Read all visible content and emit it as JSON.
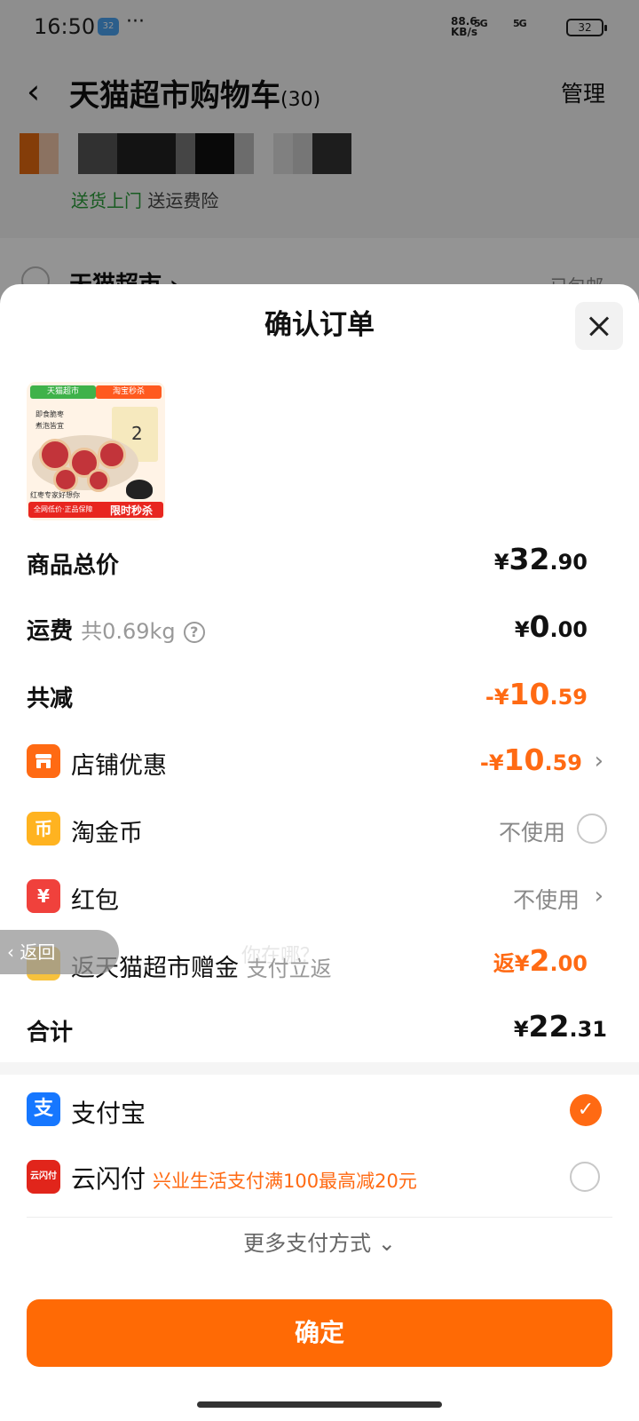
{
  "status_bar": {
    "time": "16:50",
    "weather_badge": "32",
    "dots": "···",
    "net_speed_value": "88.6",
    "net_speed_unit": "KB/s",
    "signal1": "5G",
    "signal2": "5G",
    "battery": "32"
  },
  "background_page": {
    "back_icon": "chevron-left-icon",
    "title": "天猫超市购物车",
    "count": "(30)",
    "manage": "管理",
    "addr_green": "送货上门",
    "addr_grey": "送运费险",
    "shop_name": "天猫超市 ›",
    "shop_right": "已包邮"
  },
  "sheet": {
    "title": "确认订单",
    "close_icon": "close-icon",
    "product_image": {
      "tag1": "天猫超市",
      "tag2": "淘宝秒杀",
      "text1": "即食脆枣",
      "text2": "煮泡皆宜",
      "box_num": "2",
      "sub": "红枣专家好想你",
      "bar_left": "全网低价·正品保障",
      "bar_right": "限时秒杀"
    },
    "goods_total": {
      "label": "商品总价",
      "currency": "¥",
      "int": "32",
      "dec": ".90"
    },
    "shipping": {
      "label": "运费",
      "weight": "共0.69kg",
      "help": "?",
      "currency": "¥",
      "int": "0",
      "dec": ".00"
    },
    "discount": {
      "label": "共减",
      "prefix": "-¥",
      "int": "10",
      "dec": ".59"
    },
    "shop_discount": {
      "label": "店铺优惠",
      "prefix": "-¥",
      "int": "10",
      "dec": ".59",
      "chevron": "›"
    },
    "taojinbi": {
      "label": "淘金币",
      "value": "不使用",
      "icon_char": "币"
    },
    "hongbao": {
      "label": "红包",
      "value": "不使用",
      "chevron": "›",
      "icon_char": "¥"
    },
    "cashback": {
      "label": "返天猫超市赠金",
      "sub": "支付立返",
      "prefix": "返¥",
      "int": "2",
      "dec": ".00"
    },
    "total": {
      "label": "合计",
      "currency": "¥",
      "int": "22",
      "dec": ".31"
    },
    "payments": [
      {
        "name": "支付宝",
        "icon_char": "支",
        "selected": true,
        "promo": ""
      },
      {
        "name": "云闪付",
        "icon_char": "云闪付",
        "selected": false,
        "promo": "兴业生活支付满100最高减20元"
      }
    ],
    "more_payments": "更多支付方式 ⌄",
    "confirm": "确定"
  },
  "overlay_ui": {
    "back_float": "‹ 返回",
    "watermark": "你在哪？"
  },
  "colors": {
    "accent": "#ff6a05",
    "price_orange": "#ff6a13",
    "alipay_blue": "#1677ff",
    "unionpay_red": "#e1251b"
  }
}
